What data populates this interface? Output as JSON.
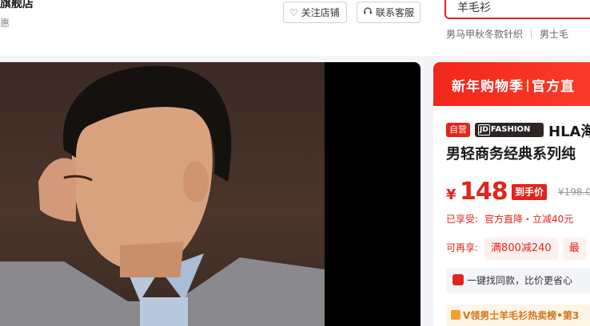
{
  "header": {
    "shop_name": "旗舰店",
    "shop_sub": "惠",
    "follow_label": "关注店铺",
    "service_label": "联系客服"
  },
  "search": {
    "value": "羊毛衫",
    "hotwords": [
      "男马甲秋冬款针织",
      "男士毛"
    ]
  },
  "gallery": {
    "image_alt": "man in grey cardigan and light blue shirt"
  },
  "product": {
    "banner": {
      "left": "新年购物季",
      "right": "官方直"
    },
    "self_tag": "自营",
    "brand_tag": "FASHION",
    "brand_tag_prefix": "JD",
    "title_line1": "HLA海",
    "title_line2": "男轻商务经典系列纯",
    "price_symbol": "¥",
    "price": "148",
    "price_label": "到手价",
    "price_old": "¥198.0",
    "enjoyed_key": "已享受:",
    "enjoyed_value": "官方直降・立减40元",
    "more_key": "可再享:",
    "coupons": [
      "满800减240",
      "最"
    ],
    "finder": "一键找同款，比价更省心",
    "rank": "V领男士羊毛衫热卖榜•第3"
  },
  "colors": {
    "accent": "#e1251b",
    "banner": "#f2271b",
    "rank_text": "#d1741a"
  }
}
